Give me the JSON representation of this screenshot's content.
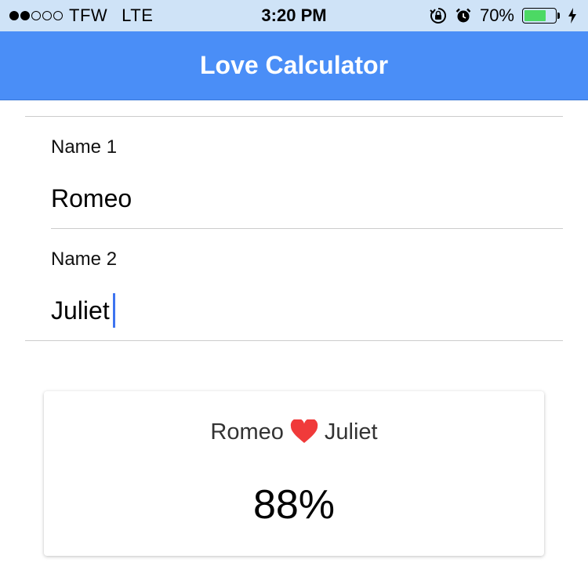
{
  "status_bar": {
    "signal_dots_filled": 2,
    "signal_dots_total": 5,
    "carrier": "TFW",
    "network": "LTE",
    "time": "3:20 PM",
    "icons": [
      "orientation-lock-icon",
      "alarm-icon",
      "charging-icon"
    ],
    "battery_text": "70%",
    "battery_level": 0.7,
    "battery_color": "#4cd964"
  },
  "nav": {
    "title": "Love Calculator",
    "color": "#4a8ef7"
  },
  "form": {
    "name1_label": "Name 1",
    "name1_value": "Romeo",
    "name2_label": "Name 2",
    "name2_value": "Juliet"
  },
  "result": {
    "name1": "Romeo",
    "name2": "Juliet",
    "heart_icon": "heart-icon",
    "heart_color": "#f03a3a",
    "percentage": "88%"
  }
}
